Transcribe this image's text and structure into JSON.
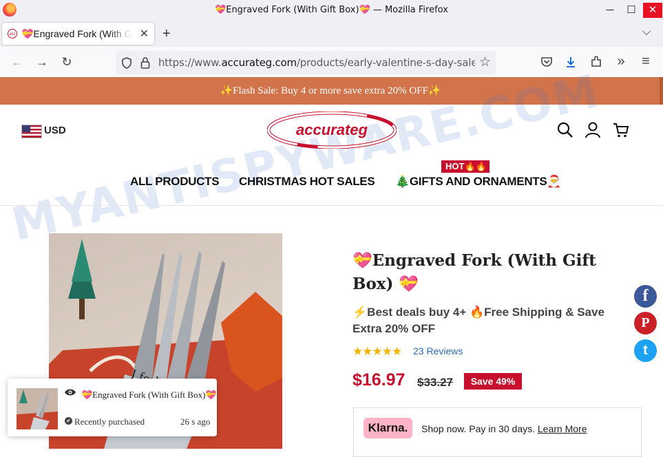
{
  "window": {
    "title": "💝Engraved Fork (With Gift Box)💝 — Mozilla Firefox",
    "minimize": "─",
    "maximize": "☐",
    "close": "✕"
  },
  "tab": {
    "label": "💝Engraved Fork (With Gift Box)💝",
    "close": "✕",
    "new_tab": "+",
    "list_all": "⌵"
  },
  "toolbar": {
    "back": "←",
    "forward": "→",
    "reload": "↻",
    "url_prefix": "https://www.",
    "url_domain": "accurateg.com",
    "url_path": "/products/early-valentine-s-day-sale-",
    "bookmark": "☆",
    "pocket": "⛉",
    "downloads": "⤓",
    "extensions": "⧉",
    "overflow": "»",
    "menu": "≡"
  },
  "banner": {
    "text": "✨Flash Sale: Buy 4 or more save extra 20% OFF✨"
  },
  "header": {
    "currency": "USD",
    "logo_text": "accurateg",
    "colors": {
      "brand": "#c8102e",
      "banner": "#d2744b"
    }
  },
  "nav": {
    "items": [
      {
        "label": "ALL PRODUCTS"
      },
      {
        "label": "CHRISTMAS HOT SALES"
      },
      {
        "label": "🎄GIFTS AND ORNAMENTS🎅"
      }
    ],
    "hot_badge": "HOT🔥🔥"
  },
  "product": {
    "title": "💝Engraved Fork (With Gift Box) 💝",
    "subtitle": "⚡Best deals buy 4+ 🔥Free Shipping & Save Extra 20% OFF",
    "stars": "★★★★★",
    "rating": 5,
    "reviews": "23 Reviews",
    "price": "$16.97",
    "old_price": "$33.27",
    "save": "Save 49%",
    "image_text": "I forki"
  },
  "klarna": {
    "logo": "Klarna.",
    "text": "Shop now. Pay in 30 days.",
    "link": "Learn More"
  },
  "share": {
    "facebook": "f",
    "pinterest": "P",
    "twitter": "t"
  },
  "popup": {
    "title": "💝Engraved Fork (With Gift Box)💝",
    "status": "Recently purchased",
    "time": "26 s ago",
    "check": "✔"
  },
  "watermark": "MYANTISPYWARE.COM"
}
